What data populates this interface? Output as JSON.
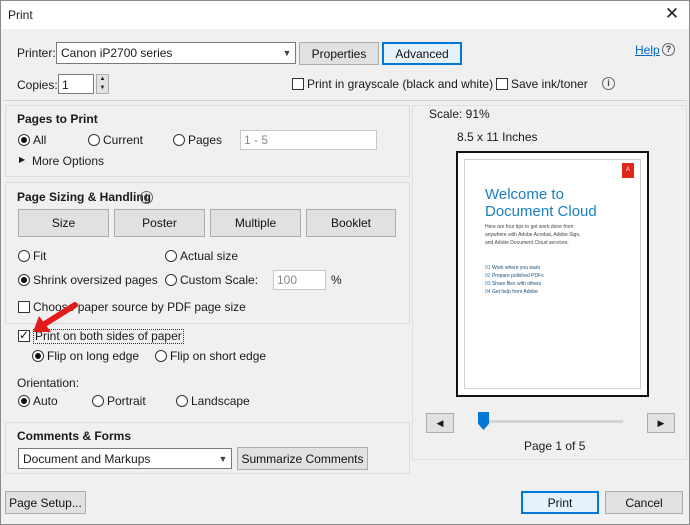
{
  "window": {
    "title": "Print"
  },
  "printer": {
    "label": "Printer:",
    "value": "Canon iP2700 series",
    "properties_label": "Properties",
    "advanced_label": "Advanced",
    "help_label": "Help"
  },
  "copies": {
    "label": "Copies:",
    "value": "1"
  },
  "options": {
    "grayscale_label": "Print in grayscale (black and white)",
    "grayscale_checked": false,
    "save_ink_label": "Save ink/toner",
    "save_ink_checked": false
  },
  "pages_to_print": {
    "heading": "Pages to Print",
    "all_label": "All",
    "current_label": "Current",
    "pages_label": "Pages",
    "pages_placeholder": "1 - 5",
    "selected": "all",
    "more_options_label": "More Options"
  },
  "page_sizing": {
    "heading": "Page Sizing & Handling",
    "buttons": [
      "Size",
      "Poster",
      "Multiple",
      "Booklet"
    ],
    "fit_label": "Fit",
    "actual_size_label": "Actual size",
    "shrink_label": "Shrink oversized pages",
    "custom_scale_label": "Custom Scale:",
    "custom_scale_value": "100",
    "percent": "%",
    "selected": "shrink",
    "choose_paper_label": "Choose paper source by PDF page size",
    "choose_paper_checked": false,
    "both_sides_label": "Print on both sides of paper",
    "both_sides_checked": true,
    "flip_long_label": "Flip on long edge",
    "flip_short_label": "Flip on short edge",
    "flip_selected": "long",
    "orientation_label": "Orientation:",
    "auto_label": "Auto",
    "portrait_label": "Portrait",
    "landscape_label": "Landscape",
    "orientation_selected": "auto"
  },
  "comments_forms": {
    "heading": "Comments & Forms",
    "value": "Document and Markups",
    "summarize_label": "Summarize Comments"
  },
  "preview": {
    "scale_text": "Scale:  91%",
    "paper_size": "8.5 x 11 Inches",
    "doc_title_line1": "Welcome to",
    "doc_title_line2": "Document Cloud",
    "doc_body": [
      "Here are four tips to get work done from",
      "anywhere with Adobe Acrobat, Adobe Sign,",
      "and Adobe Document Cloud services:"
    ],
    "tips": [
      {
        "num": "01",
        "text": "Work where you want"
      },
      {
        "num": "02",
        "text": "Prepare polished PDFs"
      },
      {
        "num": "03",
        "text": "Share files with others"
      },
      {
        "num": "04",
        "text": "Get help from Adobe"
      }
    ],
    "page_indicator": "Page 1 of 5",
    "current_page": 1,
    "total_pages": 5
  },
  "footer": {
    "page_setup_label": "Page Setup...",
    "print_label": "Print",
    "cancel_label": "Cancel"
  },
  "colors": {
    "accent": "#0078d7",
    "adobe_red": "#e1251b",
    "arrow_red": "#e21b1b",
    "doc_blue": "#1a7fc1"
  }
}
